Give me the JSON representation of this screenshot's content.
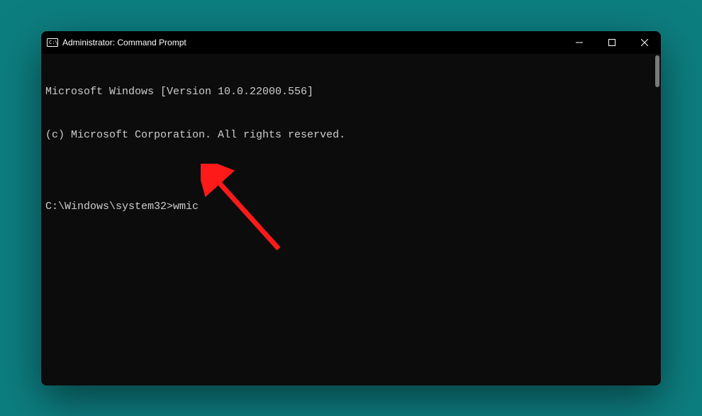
{
  "titlebar": {
    "title": "Administrator: Command Prompt"
  },
  "terminal": {
    "line1": "Microsoft Windows [Version 10.0.22000.556]",
    "line2": "(c) Microsoft Corporation. All rights reserved.",
    "blank": "",
    "prompt": "C:\\Windows\\system32>",
    "command": "wmic"
  },
  "colors": {
    "background_page": "#0d7e80",
    "window_bg": "#0c0c0c",
    "text": "#cccccc",
    "arrow": "#ff1a1a"
  }
}
